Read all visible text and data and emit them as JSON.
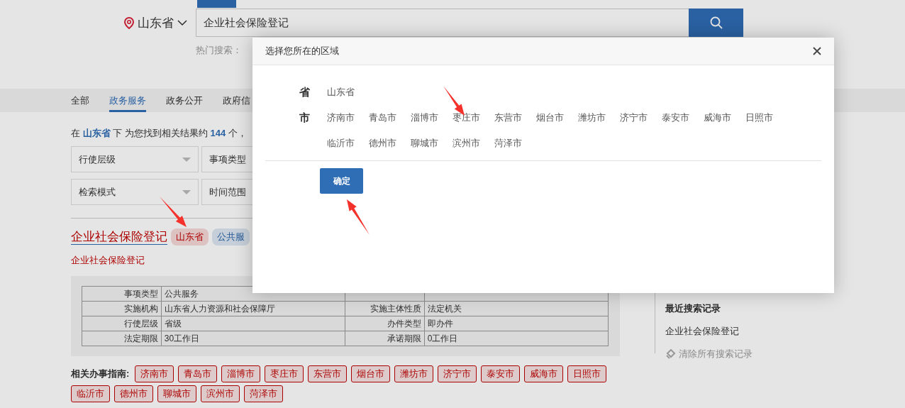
{
  "header": {
    "location": "山东省",
    "search_value": "企业社会保险登记",
    "hot_search_label": "热门搜索："
  },
  "nav_tabs": [
    {
      "label": "全部",
      "selected": false
    },
    {
      "label": "政务服务",
      "selected": true
    },
    {
      "label": "政务公开",
      "selected": false
    },
    {
      "label": "政府信",
      "selected": false
    }
  ],
  "result_summary": "在 **山东省** 下 为您找到相关结果约 **144** 个，",
  "filters": [
    {
      "label": "行使层级",
      "kind": "dropdown"
    },
    {
      "label": "事项类型",
      "kind": "cut"
    },
    {
      "label": "检索模式",
      "kind": "dropdown"
    },
    {
      "label": "时间范围",
      "kind": "cut"
    }
  ],
  "result": {
    "title": "企业社会保险登记",
    "tags": [
      {
        "label": "山东省",
        "kind": "region"
      },
      {
        "label": "公共服",
        "kind": "category"
      }
    ],
    "subtitle": "企业社会保险登记",
    "details": [
      [
        "事项类型",
        "公共服务"
      ],
      [
        "实施机构",
        "山东省人力资源和社会保障厅",
        "实施主体性质",
        "法定机关"
      ],
      [
        "行使层级",
        "省级",
        "办件类型",
        "即办件"
      ],
      [
        "法定期限",
        "30工作日",
        "承诺期限",
        "0工作日"
      ]
    ]
  },
  "related_guides": {
    "label": "相关办事指南:",
    "cities": [
      "济南市",
      "青岛市",
      "淄博市",
      "枣庄市",
      "东营市",
      "烟台市",
      "潍坊市",
      "济宁市",
      "泰安市",
      "威海市",
      "日照市",
      "临沂市",
      "德州市",
      "聊城市",
      "滨州市",
      "菏泽市"
    ]
  },
  "sidebar": {
    "heading": "最近搜索记录",
    "items": [
      "企业社会保险登记"
    ],
    "clear_label": "清除所有搜索记录"
  },
  "dialog": {
    "title": "选择您所在的区域",
    "province_label": "省",
    "province": "山东省",
    "city_label": "市",
    "cities": [
      "济南市",
      "青岛市",
      "淄博市",
      "枣庄市",
      "东营市",
      "烟台市",
      "潍坊市",
      "济宁市",
      "泰安市",
      "威海市",
      "日照市",
      "临沂市",
      "德州市",
      "聊城市",
      "滨州市",
      "菏泽市"
    ],
    "confirm": "确定"
  }
}
